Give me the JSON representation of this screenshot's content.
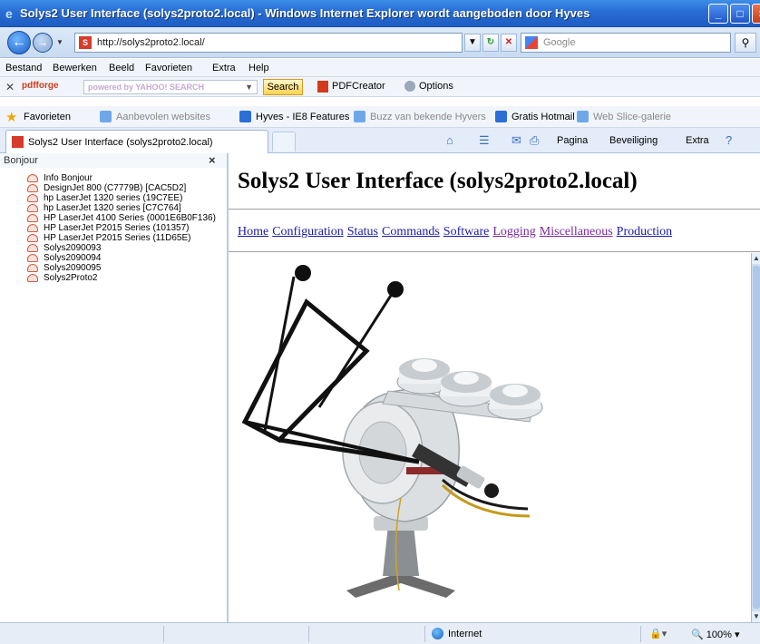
{
  "window": {
    "title": "Solys2 User Interface (solys2proto2.local) - Windows Internet Explorer wordt aangeboden door Hyves",
    "controls": [
      "_",
      "□",
      "×"
    ]
  },
  "address_bar": {
    "url": "http://solys2proto2.local/",
    "search_placeholder": "Google"
  },
  "menu": [
    "Bestand",
    "Bewerken",
    "Beeld",
    "Favorieten",
    "Extra",
    "Help"
  ],
  "pdf_toolbar": {
    "brand": "pdfforge",
    "search_placeholder": "powered by YAHOO! SEARCH",
    "search_button": "Search",
    "pdfcreator": "PDFCreator",
    "options": "Options"
  },
  "favorites_bar": {
    "label": "Favorieten",
    "items": [
      "Aanbevolen websites",
      "Hyves - IE8 Features",
      "Buzz van bekende Hyvers",
      "Gratis Hotmail",
      "Web Slice-galerie"
    ]
  },
  "tab": {
    "label": "Solys2 User Interface (solys2proto2.local)"
  },
  "command_bar": {
    "pagina": "Pagina",
    "beveiliging": "Beveiliging",
    "extra": "Extra"
  },
  "bonjour": {
    "title": "Bonjour",
    "items": [
      "Info Bonjour",
      "DesignJet 800 (C7779B) [CAC5D2]",
      "hp LaserJet 1320 series (19C7EE)",
      "hp LaserJet 1320 series [C7C764]",
      "HP LaserJet 4100 Series (0001E6B0F136)",
      "HP LaserJet P2015 Series (101357)",
      "HP LaserJet P2015 Series (11D65E)",
      "Solys2090093",
      "Solys2090094",
      "Solys2090095",
      "Solys2Proto2"
    ]
  },
  "page": {
    "title": "Solys2 User Interface (solys2proto2.local)",
    "nav": [
      {
        "label": "Home",
        "visited": false
      },
      {
        "label": "Configuration",
        "visited": false
      },
      {
        "label": "Status",
        "visited": false
      },
      {
        "label": "Commands",
        "visited": false
      },
      {
        "label": "Software",
        "visited": false
      },
      {
        "label": "Logging",
        "visited": true
      },
      {
        "label": "Miscellaneous",
        "visited": true
      },
      {
        "label": "Production",
        "visited": false
      }
    ]
  },
  "status_bar": {
    "zone": "Internet",
    "zoom": "100%"
  },
  "colors": {
    "link": "#1a1aa6",
    "visited_link": "#7a2aa0",
    "titlebar": "#2a6fd6"
  }
}
